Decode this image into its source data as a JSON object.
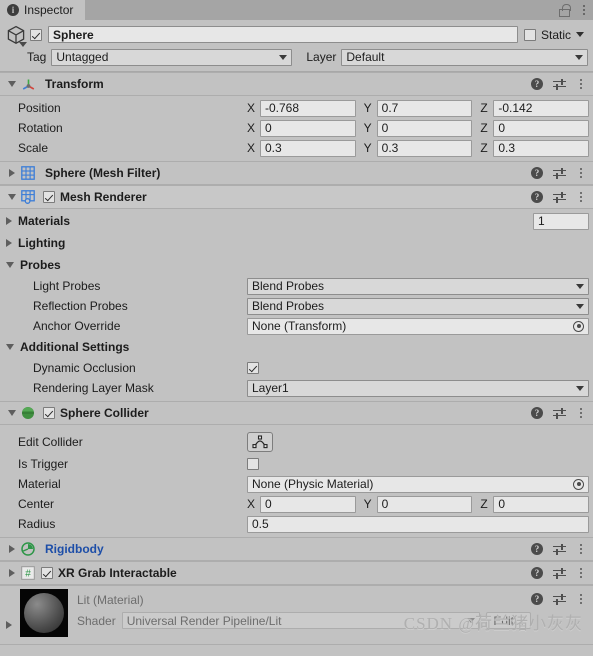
{
  "window": {
    "tab_label": "Inspector",
    "tab_icon": "info-icon",
    "lock_icon": "lock-open-icon",
    "menu_icon": "kebab-menu-icon"
  },
  "game_object": {
    "icon": "cube-icon",
    "enabled": true,
    "name": "Sphere",
    "static_label": "Static",
    "static_checked": false,
    "tag_label": "Tag",
    "tag_value": "Untagged",
    "layer_label": "Layer",
    "layer_value": "Default"
  },
  "components": [
    {
      "id": "transform",
      "title": "Transform",
      "icon": "transform-axis-icon",
      "expanded": true,
      "has_checkbox": false,
      "rows": [
        {
          "label": "Position",
          "type": "vector3",
          "x": "-0.768",
          "y": "0.7",
          "z": "-0.142"
        },
        {
          "label": "Rotation",
          "type": "vector3",
          "x": "0",
          "y": "0",
          "z": "0"
        },
        {
          "label": "Scale",
          "type": "vector3",
          "x": "0.3",
          "y": "0.3",
          "z": "0.3"
        }
      ]
    },
    {
      "id": "mesh-filter",
      "title": "Sphere (Mesh Filter)",
      "icon": "mesh-filter-grid-icon",
      "expanded": false,
      "has_checkbox": false
    },
    {
      "id": "mesh-renderer",
      "title": "Mesh Renderer",
      "icon": "mesh-renderer-icon",
      "expanded": true,
      "has_checkbox": true,
      "checked": true
    },
    {
      "id": "sphere-collider",
      "title": "Sphere Collider",
      "icon": "sphere-collider-icon",
      "expanded": true,
      "has_checkbox": true,
      "checked": true
    },
    {
      "id": "rigidbody",
      "title": "Rigidbody",
      "icon": "rigidbody-icon",
      "expanded": false,
      "has_checkbox": false,
      "title_is_link": true
    },
    {
      "id": "xr-grab-interactable",
      "title": "XR Grab Interactable",
      "icon": "script-hash-icon",
      "expanded": false,
      "has_checkbox": true,
      "checked": true
    }
  ],
  "mesh_renderer": {
    "materials_label": "Materials",
    "materials_count": "1",
    "lighting_label": "Lighting",
    "probes_label": "Probes",
    "light_probes_label": "Light Probes",
    "light_probes_value": "Blend Probes",
    "reflection_probes_label": "Reflection Probes",
    "reflection_probes_value": "Blend Probes",
    "anchor_override_label": "Anchor Override",
    "anchor_override_value": "None (Transform)",
    "additional_settings_label": "Additional Settings",
    "dynamic_occlusion_label": "Dynamic Occlusion",
    "dynamic_occlusion_checked": true,
    "rendering_layer_mask_label": "Rendering Layer Mask",
    "rendering_layer_mask_value": "Layer1"
  },
  "sphere_collider": {
    "edit_collider_label": "Edit Collider",
    "edit_collider_icon": "edit-collider-icon",
    "is_trigger_label": "Is Trigger",
    "is_trigger_checked": false,
    "material_label": "Material",
    "material_value": "None (Physic Material)",
    "center_label": "Center",
    "center_x": "0",
    "center_y": "0",
    "center_z": "0",
    "radius_label": "Radius",
    "radius_value": "0.5"
  },
  "material_preview": {
    "title": "Lit (Material)",
    "thumb_icon": "material-sphere-preview",
    "shader_label": "Shader",
    "shader_value": "Universal Render Pipeline/Lit",
    "edit_label": "Edit..."
  },
  "axis_labels": {
    "x": "X",
    "y": "Y",
    "z": "Z"
  },
  "watermark": "CSDN @荷兰猪小灰灰",
  "colors": {
    "background": "#c2c2c2",
    "tabbar": "#a5a5a5",
    "field": "#e7e7e7",
    "dropdown": "#d8d8d8",
    "link": "#1d4ea8",
    "collider_green": "#3f8f3f",
    "rigidbody_green": "#2e9648",
    "mesh_blue": "#3b7dd8"
  }
}
